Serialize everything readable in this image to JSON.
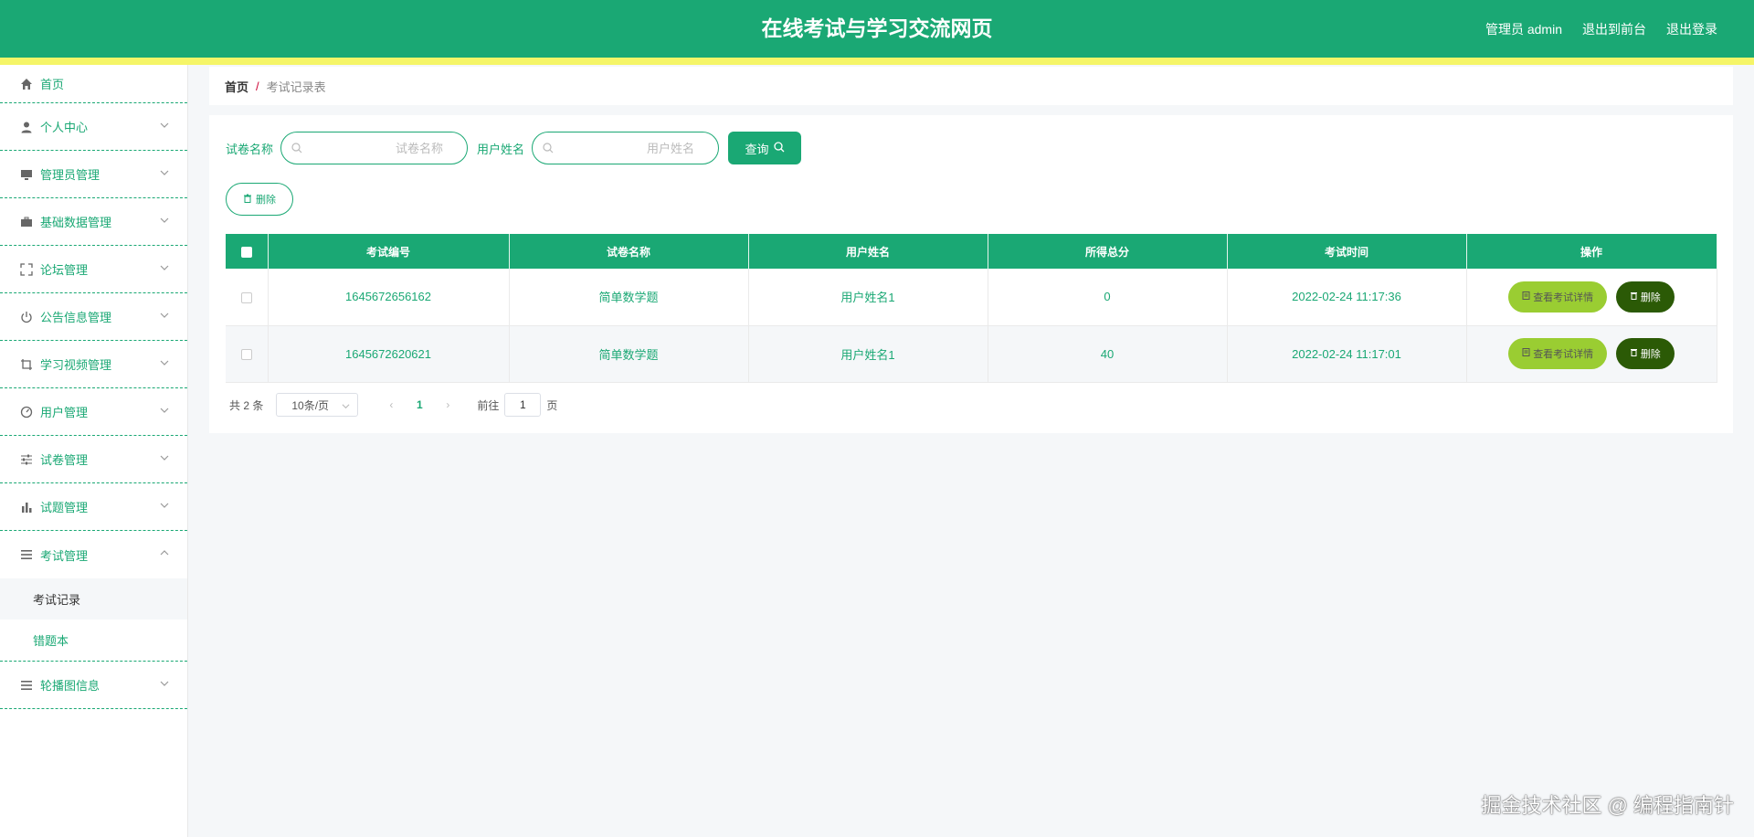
{
  "header": {
    "title": "在线考试与学习交流网页",
    "user": "管理员 admin",
    "to_front": "退出到前台",
    "logout": "退出登录"
  },
  "sidebar": {
    "items": [
      {
        "label": "首页",
        "icon": "home-icon"
      },
      {
        "label": "个人中心",
        "icon": "user-icon"
      },
      {
        "label": "管理员管理",
        "icon": "monitor-icon"
      },
      {
        "label": "基础数据管理",
        "icon": "briefcase-icon"
      },
      {
        "label": "论坛管理",
        "icon": "fullscreen-icon"
      },
      {
        "label": "公告信息管理",
        "icon": "power-icon"
      },
      {
        "label": "学习视频管理",
        "icon": "crop-icon"
      },
      {
        "label": "用户管理",
        "icon": "odometer-icon"
      },
      {
        "label": "试卷管理",
        "icon": "sliders-icon"
      },
      {
        "label": "试题管理",
        "icon": "bar-chart-icon"
      },
      {
        "label": "考试管理",
        "icon": "list-icon"
      },
      {
        "label": "轮播图信息",
        "icon": "list-icon"
      }
    ],
    "exam_sub": [
      {
        "label": "考试记录"
      },
      {
        "label": "错题本"
      }
    ]
  },
  "breadcrumb": {
    "home": "首页",
    "sep": "/",
    "current": "考试记录表"
  },
  "search": {
    "paper_label": "试卷名称",
    "paper_placeholder": "试卷名称",
    "user_label": "用户姓名",
    "user_placeholder": "用户姓名",
    "query": "查询"
  },
  "actions": {
    "delete": "删除"
  },
  "table": {
    "headers": [
      "考试编号",
      "试卷名称",
      "用户姓名",
      "所得总分",
      "考试时间",
      "操作"
    ],
    "rows": [
      {
        "id": "1645672656162",
        "paper": "简单数学题",
        "user": "用户姓名1",
        "score": "0",
        "time": "2022-02-24 11:17:36",
        "detail": "查看考试详情",
        "delete": "删除"
      },
      {
        "id": "1645672620621",
        "paper": "简单数学题",
        "user": "用户姓名1",
        "score": "40",
        "time": "2022-02-24 11:17:01",
        "detail": "查看考试详情",
        "delete": "删除"
      }
    ]
  },
  "pagination": {
    "total": "共 2 条",
    "page_size": "10条/页",
    "current_page": "1",
    "goto": "前往",
    "goto_value": "1",
    "page_unit": "页"
  },
  "watermark": "掘金技术社区 @ 编程指南针",
  "colors": {
    "primary": "#1aa874",
    "stripe": "#f5f568",
    "detail_btn": "#9acd32",
    "delete_btn": "#2b5a06"
  }
}
